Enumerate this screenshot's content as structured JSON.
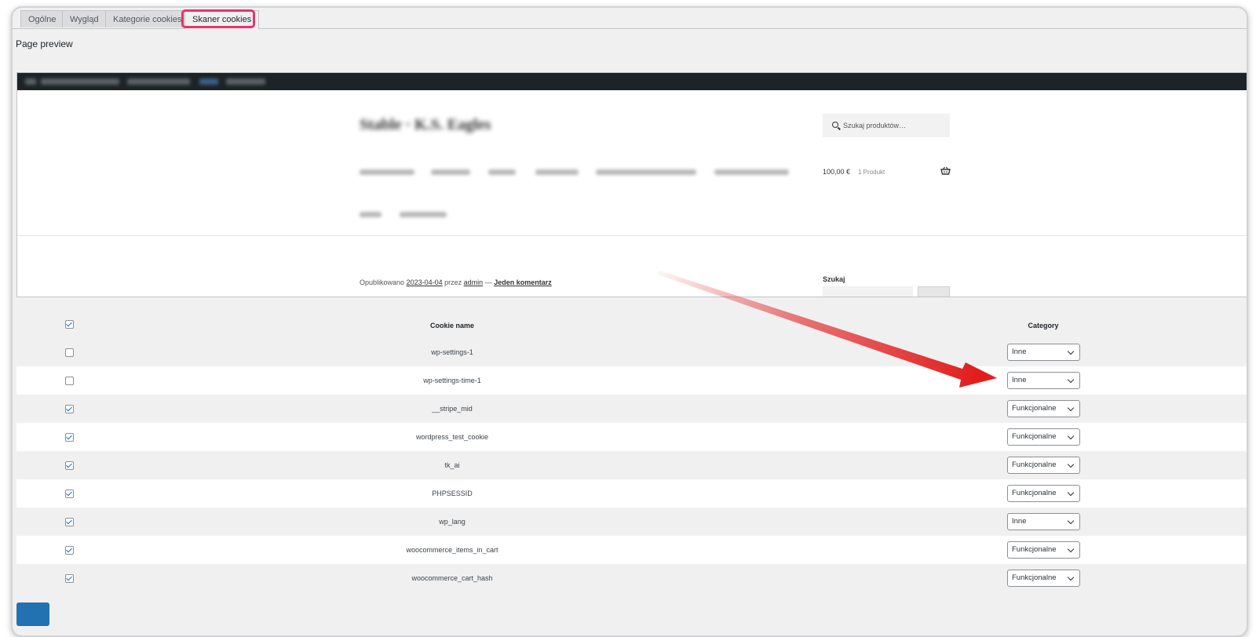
{
  "tabs": [
    {
      "label": "Ogólne"
    },
    {
      "label": "Wygląd"
    },
    {
      "label": "Kategorie cookies"
    },
    {
      "label": "Skaner cookies",
      "active": true
    }
  ],
  "page_preview_label": "Page preview",
  "preview": {
    "search_placeholder": "Szukaj produktów…",
    "cart_price": "100,00 €",
    "cart_count": "1 Produkt",
    "post_meta": {
      "published": "Opublikowano",
      "date": "2023-04-04",
      "by": "przez",
      "author": "admin",
      "dash": "—",
      "comments": "Jeden komentarz"
    },
    "sidebar_search_title": "Szukaj"
  },
  "table": {
    "header": {
      "name": "Cookie name",
      "category": "Category",
      "checked": true
    },
    "rows": [
      {
        "name": "wp-settings-1",
        "category": "Inne",
        "checked": false
      },
      {
        "name": "wp-settings-time-1",
        "category": "Inne",
        "checked": false
      },
      {
        "name": "__stripe_mid",
        "category": "Funkcjonalne",
        "checked": true
      },
      {
        "name": "wordpress_test_cookie",
        "category": "Funkcjonalne",
        "checked": true
      },
      {
        "name": "tk_ai",
        "category": "Funkcjonalne",
        "checked": true
      },
      {
        "name": "PHPSESSID",
        "category": "Funkcjonalne",
        "checked": true
      },
      {
        "name": "wp_lang",
        "category": "Inne",
        "checked": true
      },
      {
        "name": "woocommerce_items_in_cart",
        "category": "Funkcjonalne",
        "checked": true
      },
      {
        "name": "woocommerce_cart_hash",
        "category": "Funkcjonalne",
        "checked": true
      }
    ]
  },
  "colors": {
    "highlight": "#e8336a",
    "arrow": "#e11d1d",
    "accent": "#2271b1"
  }
}
